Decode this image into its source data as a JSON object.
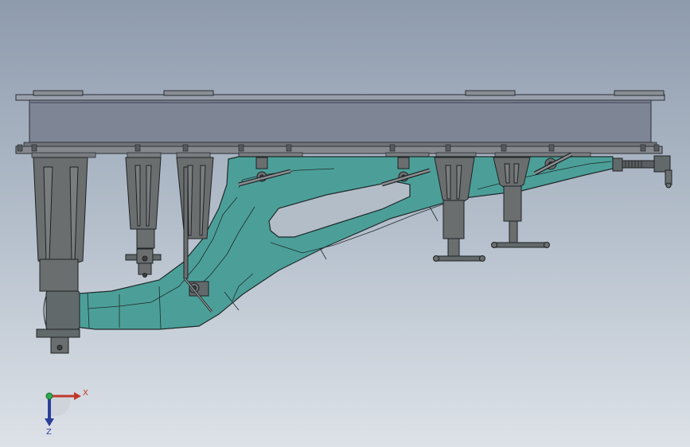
{
  "view": {
    "background_top": "#8e9bad",
    "background_bottom": "#dde2e8"
  },
  "model": {
    "beam_color": "#7e8595",
    "fixture_color": "#6b6e6f",
    "part_color": "#4c9f99",
    "edge_color": "#1e2a2a"
  },
  "triad": {
    "x_label": "X",
    "z_label": "Z",
    "x_color": "#c0392b",
    "z_color": "#2a3f9a",
    "origin_color": "#2ea84a"
  }
}
